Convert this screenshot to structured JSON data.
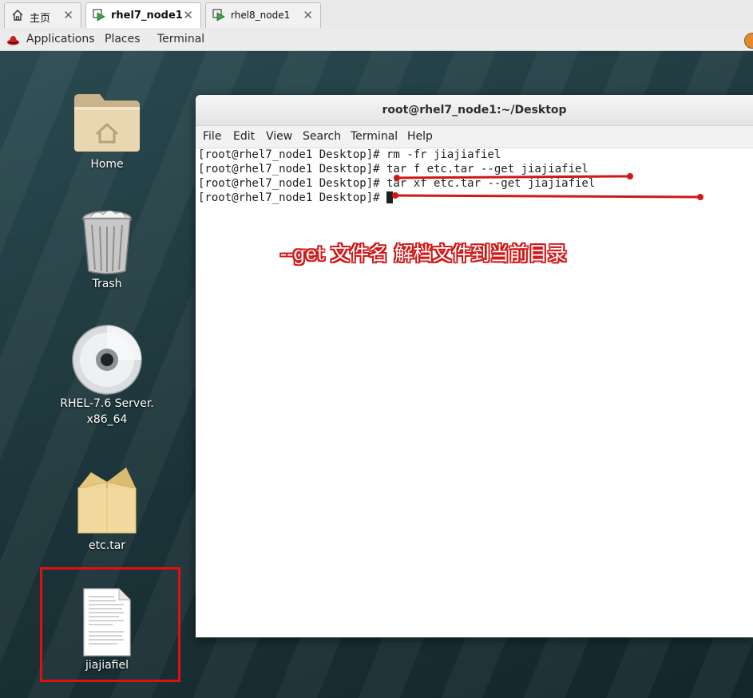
{
  "tabs": [
    {
      "label": "主页",
      "icon": "home-icon",
      "active": false
    },
    {
      "label": "rhel7_node1",
      "icon": "vm-icon",
      "active": true
    },
    {
      "label": "rhel8_node1",
      "icon": "vm-icon",
      "active": false
    }
  ],
  "topbar": {
    "applications": "Applications",
    "places": "Places",
    "terminal": "Terminal"
  },
  "desktop": {
    "icons": [
      {
        "label": "Home",
        "icon": "home-folder-icon"
      },
      {
        "label": "Trash",
        "icon": "trash-icon"
      },
      {
        "label": "RHEL-7.6 Server.",
        "label2": "x86_64",
        "icon": "disc-icon"
      },
      {
        "label": "etc.tar",
        "icon": "archive-icon"
      },
      {
        "label": "jiajiafiel",
        "icon": "text-file-icon"
      }
    ]
  },
  "terminal": {
    "title": "root@rhel7_node1:~/Desktop",
    "menu": [
      "File",
      "Edit",
      "View",
      "Search",
      "Terminal",
      "Help"
    ],
    "lines": [
      "[root@rhel7_node1 Desktop]# rm -fr jiajiafiel",
      "[root@rhel7_node1 Desktop]# tar f etc.tar --get jiajiafiel",
      "[root@rhel7_node1 Desktop]# tar xf etc.tar --get jiajiafiel",
      "[root@rhel7_node1 Desktop]# "
    ],
    "annotation": "--get 文件名  解档文件到当前目录"
  },
  "colors": {
    "annotation_red": "#d01818",
    "highlight_red": "#e01010"
  }
}
